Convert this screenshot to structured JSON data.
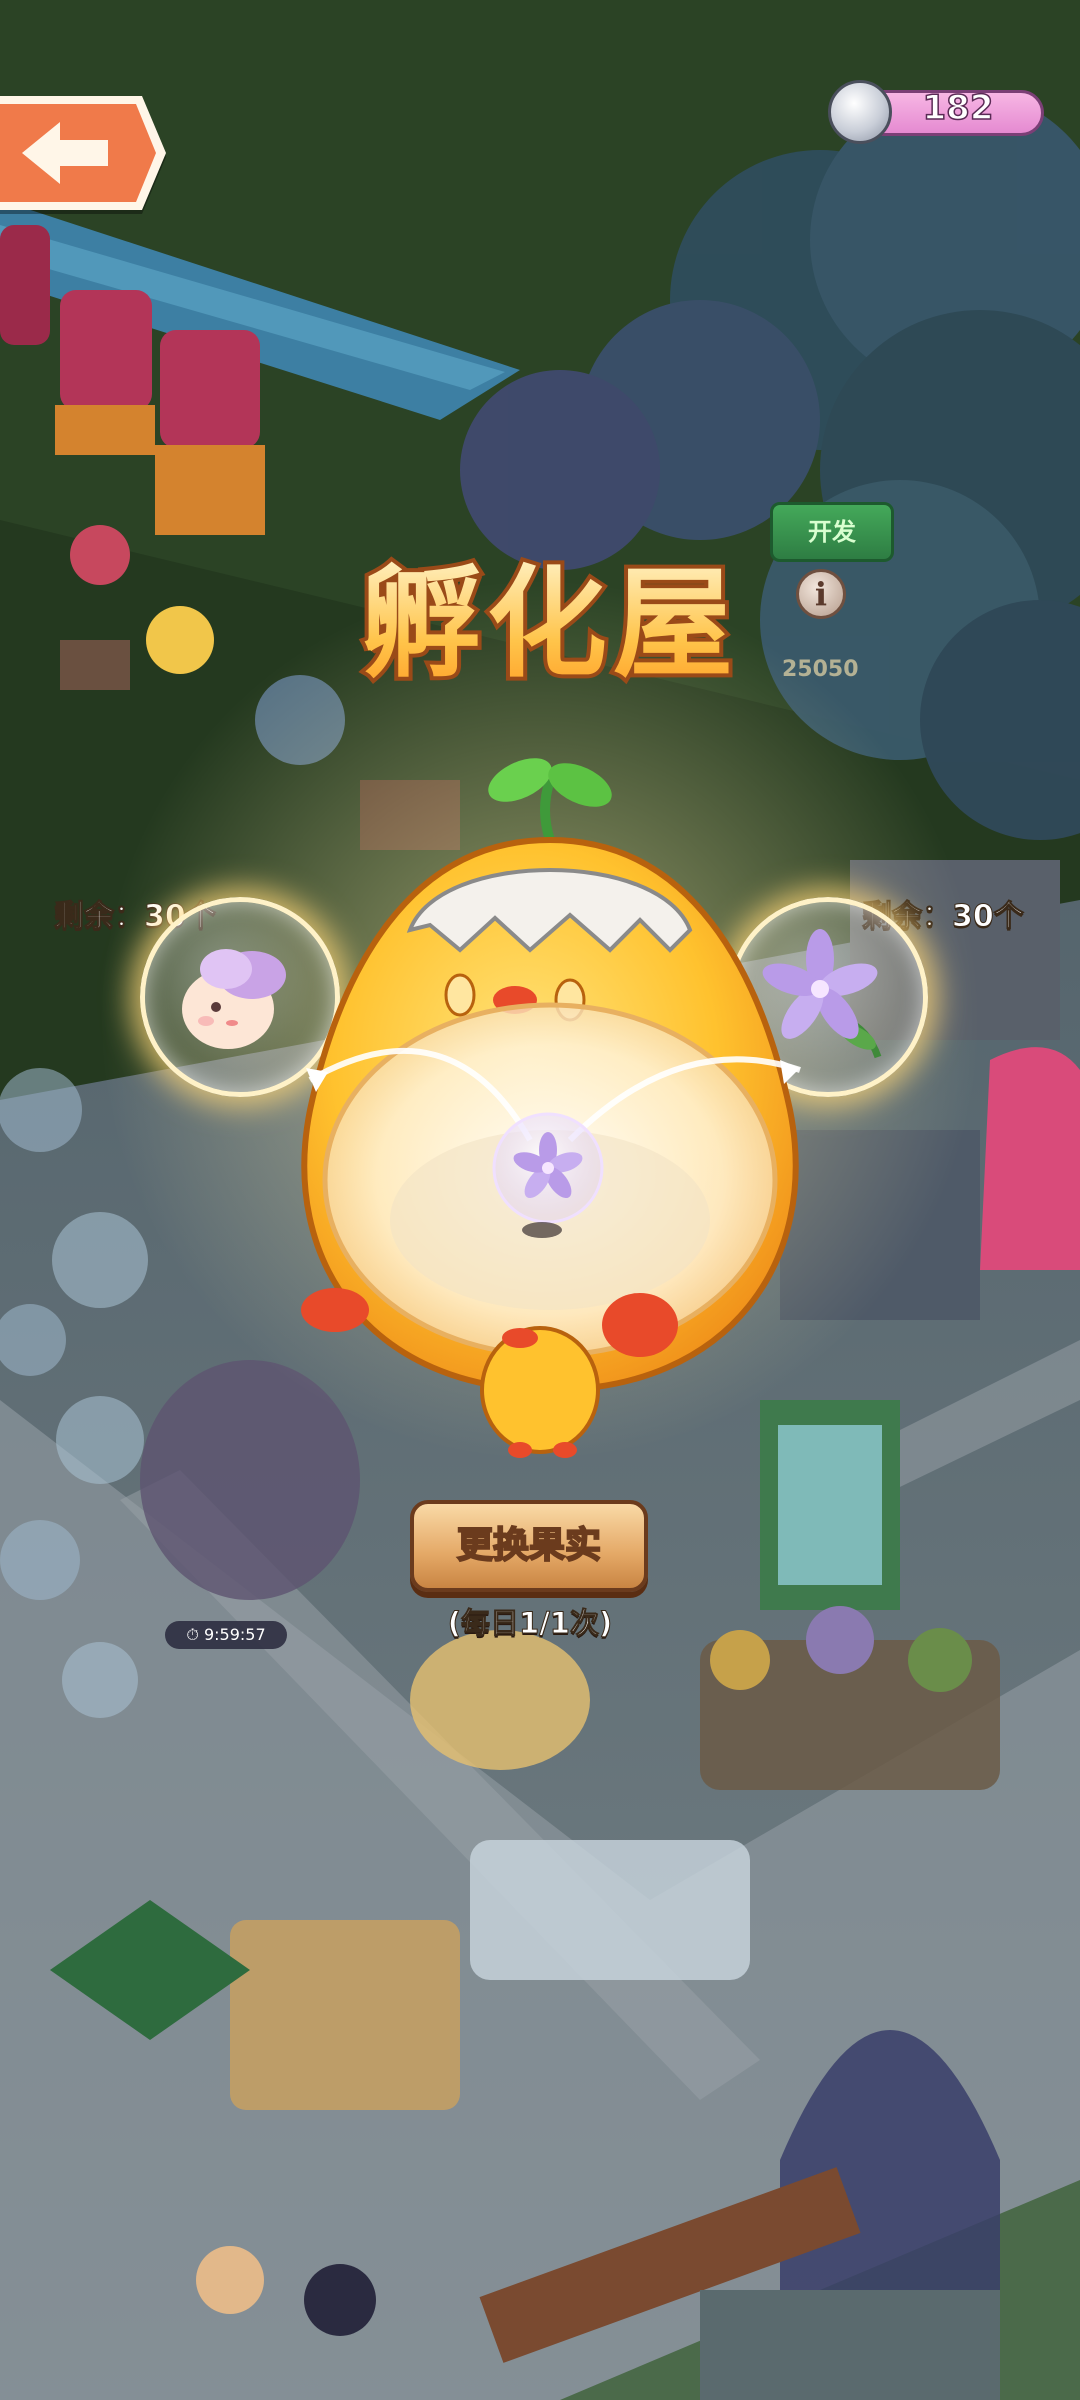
{
  "header": {
    "currency": {
      "amount": "182",
      "icon": "silver-coin-icon"
    },
    "back_icon": "back-arrow-icon"
  },
  "hatch_house": {
    "title": "孵化屋",
    "info_icon_label": "i",
    "left_slot": {
      "remaining_text": "剩余：30个",
      "item": "flower-bun-creature"
    },
    "right_slot": {
      "remaining_text": "剩余：30个",
      "item": "purple-lily-flower"
    },
    "center_item": "purple-lily-flower",
    "swap_button_label": "更换果实",
    "daily_limit_text": "(每日1/1次)"
  },
  "background": {
    "dev_badge": "开发",
    "price_tag": "25050",
    "timer": "9:59:57"
  },
  "colors": {
    "title_fill": "#ffd56b",
    "title_outline": "#9a4a18",
    "button_fill": "#e4a866",
    "currency_pill": "#e58ad1"
  }
}
